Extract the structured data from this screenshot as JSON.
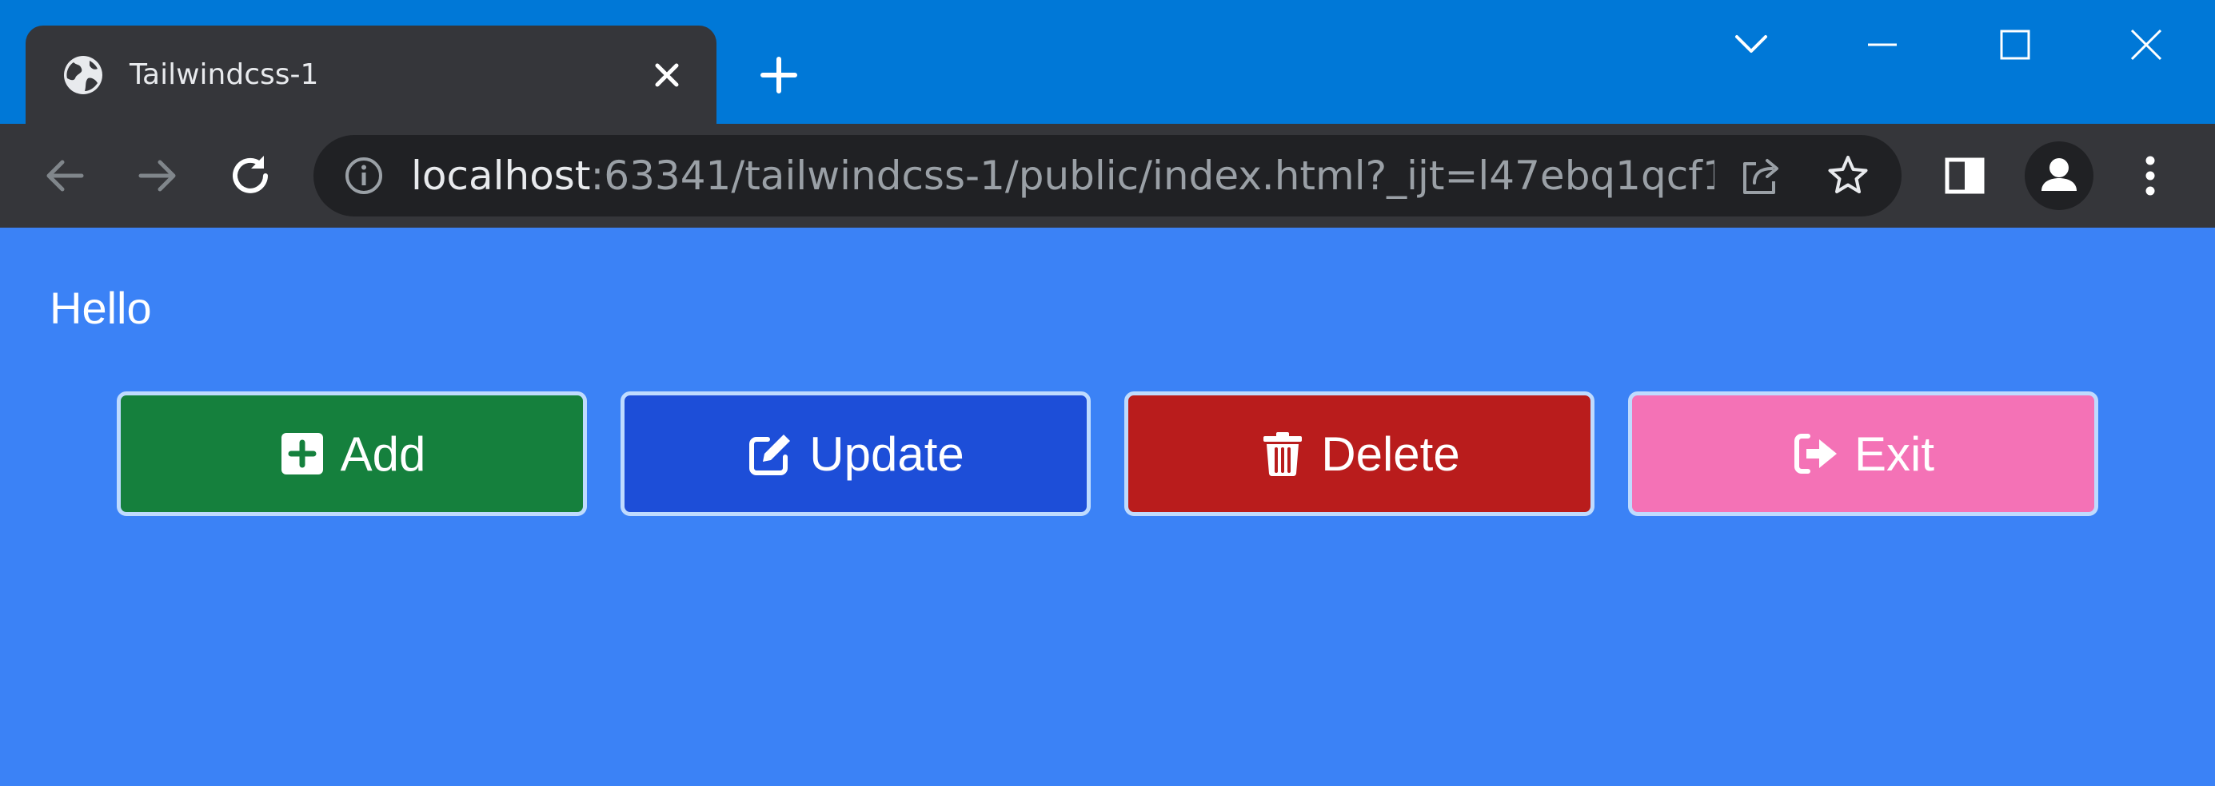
{
  "browser": {
    "tab": {
      "title": "Tailwindcss-1"
    },
    "address_bar": {
      "host": "localhost",
      "rest": ":63341/tailwindcss-1/public/index.html?_ijt=l47ebq1qcf1..."
    }
  },
  "page": {
    "greeting": "Hello",
    "buttons": {
      "add": "Add",
      "update": "Update",
      "delete": "Delete",
      "exit": "Exit"
    }
  },
  "colors": {
    "titlebar": "#0078d7",
    "toolbar": "#35363a",
    "page_background": "#3b82f6",
    "add": "#15803d",
    "update": "#1d4ed8",
    "delete": "#b91c1c",
    "exit": "#f472b6"
  },
  "icons": {
    "tab_favicon": "globe-icon",
    "add": "plus-square-icon",
    "update": "edit-icon",
    "delete": "trash-icon",
    "exit": "sign-out-icon"
  }
}
